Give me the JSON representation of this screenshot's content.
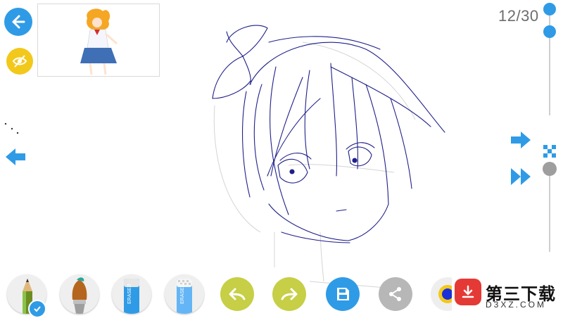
{
  "page_counter": "12/30",
  "watermark": {
    "title": "第三下载",
    "url": "D3XZ.COM"
  },
  "tools": [
    {
      "name": "pencil",
      "selected": true
    },
    {
      "name": "brush",
      "selected": false
    },
    {
      "name": "eraser",
      "label": "ERASER"
    },
    {
      "name": "soft-eraser",
      "label": "ERASER"
    }
  ],
  "actions": [
    "undo",
    "redo",
    "save",
    "share",
    "color-picker"
  ],
  "colors": {
    "accent_blue": "#2f9be6",
    "accent_yellow": "#f2c81b",
    "action_green": "#c6cf46",
    "sketch_line": "#1f1f8a"
  }
}
